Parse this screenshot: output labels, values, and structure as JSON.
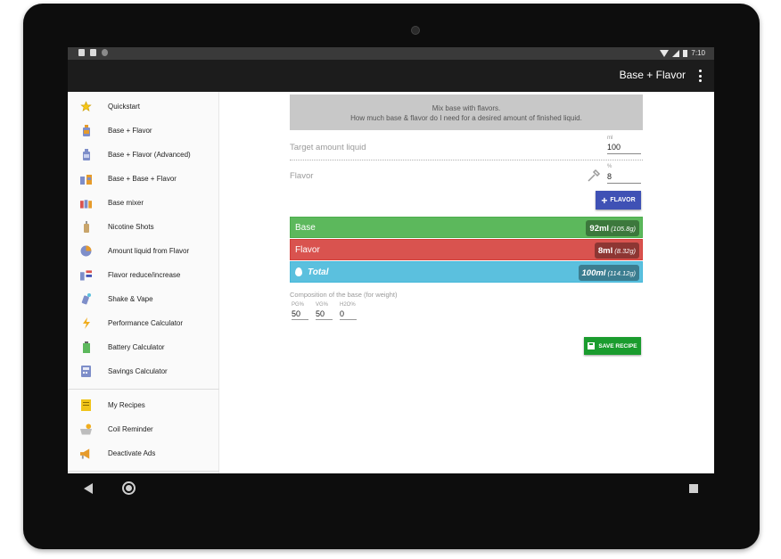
{
  "status_bar": {
    "time": "7:10"
  },
  "app_bar": {
    "title": "Base + Flavor",
    "overflow_icon": "more-vert-icon"
  },
  "drawer": {
    "items": [
      {
        "label": "Quickstart",
        "icon": "star-icon"
      },
      {
        "label": "Base + Flavor",
        "icon": "bottle-icon"
      },
      {
        "label": "Base + Flavor (Advanced)",
        "icon": "bottle-advanced-icon"
      },
      {
        "label": "Base + Base + Flavor",
        "icon": "bottles-icon"
      },
      {
        "label": "Base mixer",
        "icon": "mixer-icon"
      },
      {
        "label": "Nicotine Shots",
        "icon": "nicotine-icon"
      },
      {
        "label": "Amount liquid from Flavor",
        "icon": "pie-chart-icon"
      },
      {
        "label": "Flavor reduce/increase",
        "icon": "reduce-increase-icon"
      },
      {
        "label": "Shake & Vape",
        "icon": "shake-icon"
      },
      {
        "label": "Performance Calculator",
        "icon": "lightning-icon"
      },
      {
        "label": "Battery Calculator",
        "icon": "battery-icon"
      },
      {
        "label": "Savings Calculator",
        "icon": "calculator-icon"
      }
    ],
    "secondary_items": [
      {
        "label": "My Recipes",
        "icon": "recipe-book-icon"
      },
      {
        "label": "Coil Reminder",
        "icon": "coil-icon"
      },
      {
        "label": "Deactivate Ads",
        "icon": "megaphone-icon"
      }
    ]
  },
  "main": {
    "banner_line1": "Mix base with flavors.",
    "banner_line2": "How much base & flavor do I need for a desired amount of finished liquid.",
    "target": {
      "label": "Target amount liquid",
      "unit": "ml",
      "value": "100"
    },
    "flavor": {
      "label": "Flavor",
      "unit": "%",
      "value": "8"
    },
    "add_flavor_button": "FLAVOR",
    "results": {
      "base": {
        "label": "Base",
        "ml": "92ml",
        "grams": "(105.8g)",
        "color": "#5cb85c"
      },
      "flavor": {
        "label": "Flavor",
        "ml": "8ml",
        "grams": "(8.32g)",
        "color": "#d9534f"
      },
      "total": {
        "label": "Total",
        "ml": "100ml",
        "grams": "(114.12g)",
        "color": "#5bc0de"
      }
    },
    "composition": {
      "label": "Composition of the base (for weight)",
      "pg": {
        "label": "PG%",
        "value": "50"
      },
      "vg": {
        "label": "VG%",
        "value": "50"
      },
      "h2o": {
        "label": "H2O%",
        "value": "0"
      }
    },
    "save_button": "SAVE RECIPE"
  }
}
